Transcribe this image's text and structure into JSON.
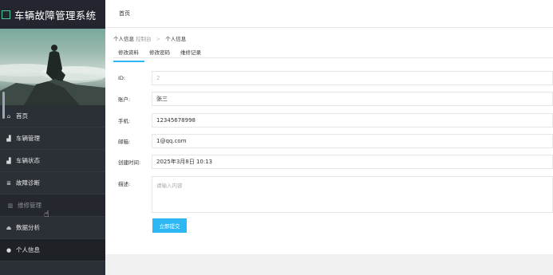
{
  "app": {
    "title": "车辆故障管理系统"
  },
  "sidebar": {
    "items": [
      {
        "label": "首页",
        "icon": "home-icon"
      },
      {
        "label": "车辆管理",
        "icon": "bar-chart-icon"
      },
      {
        "label": "车辆状态",
        "icon": "bar-chart-icon"
      },
      {
        "label": "故障诊断",
        "icon": "database-icon"
      },
      {
        "label": "维修管理",
        "icon": "trash-icon"
      },
      {
        "label": "数据分析",
        "icon": "eject-icon"
      },
      {
        "label": "个人信息",
        "icon": "user-icon"
      }
    ]
  },
  "topbar": {
    "home": "首页"
  },
  "breadcrumb": {
    "section": "个人信息",
    "area": "控制台",
    "page": "个人信息"
  },
  "tabs": [
    "修改资料",
    "修改密码",
    "维修记录"
  ],
  "form": {
    "id_label": "ID:",
    "id_value": "2",
    "account_label": "账户:",
    "account_value": "张三",
    "phone_label": "手机:",
    "phone_value": "12345678998",
    "email_label": "邮箱:",
    "email_value": "1@qq.com",
    "created_label": "创建时间:",
    "created_value": "2025年3月8日 10:13",
    "desc_label": "描述:",
    "desc_placeholder": "请输入内容",
    "submit": "立即提交"
  },
  "colors": {
    "accent": "#2db7f5",
    "sidebar": "#2b2f36"
  }
}
